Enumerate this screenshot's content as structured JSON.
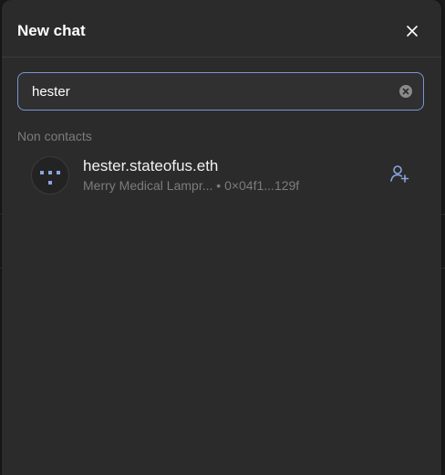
{
  "dialog": {
    "title": "New chat",
    "search": {
      "value": "hester",
      "placeholder": ""
    },
    "section_label": "Non contacts",
    "results": [
      {
        "name": "hester.stateofus.eth",
        "description": "Merry Medical Lampr...",
        "separator": "•",
        "address": "0×04f1...129f"
      }
    ]
  },
  "colors": {
    "accent": "#7a94d6",
    "modal_bg": "#2b2b2b",
    "muted_text": "#7c7c7c"
  },
  "icons": [
    "close-icon",
    "clear-icon",
    "add-contact-icon",
    "identicon-avatar"
  ]
}
